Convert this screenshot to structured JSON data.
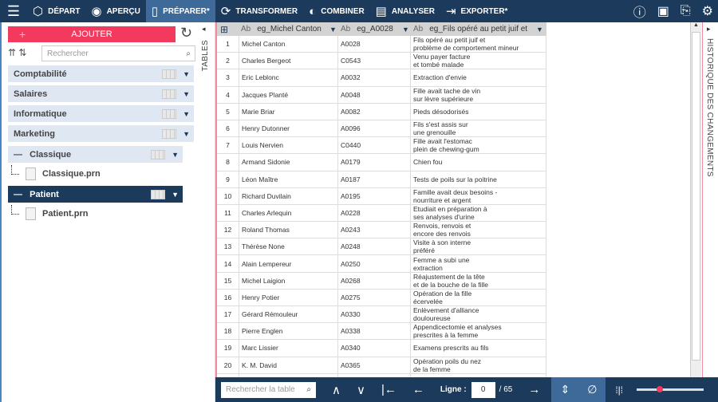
{
  "nav": {
    "items": [
      {
        "label": "DÉPART",
        "icon": "cube-icon"
      },
      {
        "label": "APERÇU",
        "icon": "eye-icon"
      },
      {
        "label": "PRÉPARER*",
        "icon": "columns-icon"
      },
      {
        "label": "TRANSFORMER",
        "icon": "cycle-icon"
      },
      {
        "label": "COMBINER",
        "icon": "combine-icon"
      },
      {
        "label": "ANALYSER",
        "icon": "clipboard-icon"
      },
      {
        "label": "EXPORTER*",
        "icon": "export-icon"
      }
    ]
  },
  "left": {
    "add_label": "AJOUTER",
    "search_placeholder": "Rechercher",
    "groups": [
      "Comptabilité",
      "Salaires",
      "Informatique",
      "Marketing"
    ],
    "classique": {
      "label": "Classique",
      "file": "Classique.prn"
    },
    "patient": {
      "label": "Patient",
      "file": "Patient.prn"
    },
    "collapse": "—"
  },
  "strips": {
    "tables": "TABLES",
    "history": "HISTORIQUE DES CHANGEMENTS"
  },
  "table": {
    "type_label": "Ab",
    "headers": [
      "eg_Michel Canton",
      "eg_A0028",
      "eg_Fils opéré au petit juif et"
    ],
    "rows": [
      [
        "1",
        "Michel Canton",
        "A0028",
        "Fils opéré au petit juif et\nproblème de comportement mineur"
      ],
      [
        "2",
        "Charles Bergeot",
        "C0543",
        "Venu payer facture\net tombé malade"
      ],
      [
        "3",
        "Eric Leblonc",
        "A0032",
        "Extraction d'envie"
      ],
      [
        "4",
        "Jacques Planté",
        "A0048",
        "Fille avait tache de vin\nsur lèvre supérieure"
      ],
      [
        "5",
        "Marie Briar",
        "A0082",
        "Pieds désodorisés"
      ],
      [
        "6",
        "Henry Dutonner",
        "A0096",
        "Fils s'est assis sur\nune grenouille"
      ],
      [
        "7",
        "Louis Nervien",
        "C0440",
        "Fille avait l'estomac\nplein de chewing-gum"
      ],
      [
        "8",
        "Armand Sidonie",
        "A0179",
        "Chien fou"
      ],
      [
        "9",
        "Léon Maître",
        "A0187",
        "Tests de poils sur la poitrine"
      ],
      [
        "10",
        "Richard Duvilain",
        "A0195",
        "Famille avait deux besoins -\nnourriture et argent"
      ],
      [
        "11",
        "Charles Arlequin",
        "A0228",
        "Etudiait en préparation à\nses analyses d'urine"
      ],
      [
        "12",
        "Roland Thomas",
        "A0243",
        "Renvois, renvois et\nencore des renvois"
      ],
      [
        "13",
        "Thérèse None",
        "A0248",
        "Visite à son interne\npréféré"
      ],
      [
        "14",
        "Alain Lempereur",
        "A0250",
        "Femme a subi une\nextraction"
      ],
      [
        "15",
        "Michel Laigion",
        "A0268",
        "Réajustement de la tête\net de la bouche de la fille"
      ],
      [
        "16",
        "Henry Potier",
        "A0275",
        "Opération de la fille\nécervelée"
      ],
      [
        "17",
        "Gérard Rémouleur",
        "A0330",
        "Enlèvement d'alliance\ndouloureuse"
      ],
      [
        "18",
        "Pierre Englen",
        "A0338",
        "Appendicectomie et analyses\nprescrites à la femme"
      ],
      [
        "19",
        "Marc Lissier",
        "A0340",
        "Examens prescrits au fils"
      ],
      [
        "20",
        "K. M. David",
        "A0365",
        "Opération poils du nez\nde la femme"
      ],
      [
        "",
        "",
        "",
        ""
      ]
    ]
  },
  "bottom": {
    "search_placeholder": "Rechercher la table",
    "line_label": "Ligne :",
    "line_value": "0",
    "total": "/ 65",
    "zoom_level": 0.35
  }
}
